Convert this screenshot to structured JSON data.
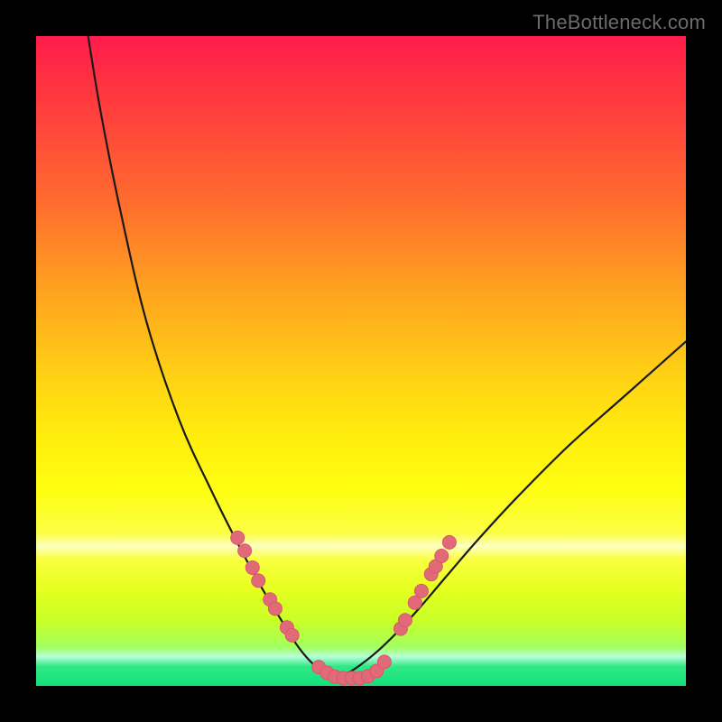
{
  "watermark": {
    "text": "TheBottleneck.com"
  },
  "accent": {
    "dot_fill": "#e06a78",
    "dot_stroke": "#d9576a",
    "curve": "#1a1a1a"
  },
  "chart_data": {
    "type": "line",
    "title": "",
    "xlabel": "",
    "ylabel": "",
    "xlim": [
      0,
      100
    ],
    "ylim": [
      0,
      100
    ],
    "grid": false,
    "legend": false,
    "series": [
      {
        "name": "left-branch",
        "x": [
          8,
          10,
          13,
          17,
          22,
          27,
          31,
          34.5,
          37.5,
          40,
          42,
          44,
          46
        ],
        "y": [
          100,
          88,
          73,
          56,
          41,
          30,
          22,
          15.5,
          10.5,
          6.5,
          4,
          2.3,
          1.3
        ]
      },
      {
        "name": "right-branch",
        "x": [
          46,
          48,
          50,
          52.5,
          55.5,
          59,
          63,
          68,
          74,
          82,
          91,
          100
        ],
        "y": [
          1.3,
          2.0,
          3.3,
          5.3,
          8.2,
          12,
          16.7,
          22.5,
          29,
          37,
          45,
          53
        ]
      }
    ],
    "dots_left": [
      {
        "x": 31.0,
        "y": 22.8
      },
      {
        "x": 32.1,
        "y": 20.8
      },
      {
        "x": 33.3,
        "y": 18.2
      },
      {
        "x": 34.2,
        "y": 16.2
      },
      {
        "x": 36.0,
        "y": 13.3
      },
      {
        "x": 36.8,
        "y": 11.9
      },
      {
        "x": 38.6,
        "y": 9.0
      },
      {
        "x": 39.4,
        "y": 7.8
      }
    ],
    "dots_valley": [
      {
        "x": 43.5,
        "y": 2.9
      },
      {
        "x": 44.8,
        "y": 2.0
      },
      {
        "x": 46.0,
        "y": 1.4
      },
      {
        "x": 47.3,
        "y": 1.2
      },
      {
        "x": 48.6,
        "y": 1.2
      },
      {
        "x": 49.8,
        "y": 1.2
      },
      {
        "x": 51.1,
        "y": 1.5
      },
      {
        "x": 52.4,
        "y": 2.3
      },
      {
        "x": 53.6,
        "y": 3.7
      }
    ],
    "dots_right": [
      {
        "x": 56.1,
        "y": 8.8
      },
      {
        "x": 56.8,
        "y": 10.1
      },
      {
        "x": 58.3,
        "y": 12.8
      },
      {
        "x": 59.3,
        "y": 14.6
      },
      {
        "x": 60.8,
        "y": 17.2
      },
      {
        "x": 61.5,
        "y": 18.4
      },
      {
        "x": 62.4,
        "y": 20.0
      },
      {
        "x": 63.6,
        "y": 22.1
      }
    ]
  }
}
